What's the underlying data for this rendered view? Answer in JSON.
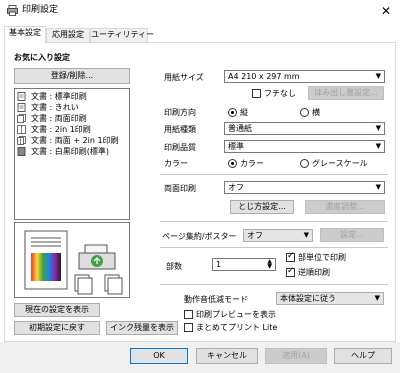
{
  "window": {
    "title": "印刷設定",
    "close_glyph": "✕"
  },
  "tabs": [
    {
      "label": "基本設定",
      "active": true
    },
    {
      "label": "応用設定",
      "active": false
    },
    {
      "label": "ユーティリティー",
      "active": false
    }
  ],
  "favorites": {
    "heading": "お気に入り設定",
    "register_button": "登録/削除...",
    "items": [
      {
        "label": "文書 : 標準印刷",
        "icon": "document-icon"
      },
      {
        "label": "文書 : きれい",
        "icon": "document-icon"
      },
      {
        "label": "文書 : 両面印刷",
        "icon": "duplex-icon"
      },
      {
        "label": "文書 : 2in 1印刷",
        "icon": "two-up-icon"
      },
      {
        "label": "文書 : 両面 + 2in 1印刷",
        "icon": "duplex-two-up-icon"
      },
      {
        "label": "文書 : 白黒印刷(標準)",
        "icon": "monochrome-icon"
      }
    ]
  },
  "left_buttons": {
    "show_current": "現在の設定を表示",
    "reset": "初期設定に戻す",
    "ink_levels": "インク残量を表示"
  },
  "settings": {
    "paper_size": {
      "label": "用紙サイズ",
      "value": "A4 210 x 297 mm"
    },
    "borderless": {
      "label": "フチなし",
      "checked": false
    },
    "overflow_button": "はみ出し量設定...",
    "orientation": {
      "label": "印刷方向",
      "options": [
        "縦",
        "横"
      ],
      "selected": "縦"
    },
    "paper_type": {
      "label": "用紙種類",
      "value": "普通紙"
    },
    "quality": {
      "label": "印刷品質",
      "value": "標準"
    },
    "color": {
      "label": "カラー",
      "options": [
        "カラー",
        "グレースケール"
      ],
      "selected": "カラー"
    },
    "duplex": {
      "label": "両面印刷",
      "value": "オフ"
    },
    "binding_button": "とじ方設定...",
    "density_button": "濃度調整...",
    "page_layout": {
      "label": "ページ集約/ポスター",
      "value": "オフ"
    },
    "layout_settings_button": "設定...",
    "copies": {
      "label": "部数",
      "value": "1"
    },
    "collate": {
      "label": "部単位で印刷",
      "checked": true
    },
    "reverse": {
      "label": "逆順印刷",
      "checked": true
    },
    "quiet_mode": {
      "label": "動作音低減モード",
      "value": "本体設定に従う"
    },
    "print_preview": {
      "label": "印刷プレビューを表示",
      "checked": false
    },
    "job_arranger": {
      "label": "まとめてプリント Lite",
      "checked": false
    }
  },
  "dialog_buttons": {
    "ok": "OK",
    "cancel": "キャンセル",
    "apply": "適用(A)",
    "help": "ヘルプ"
  },
  "colors": {
    "accent": "#0078d7",
    "disabled_text": "#a0a0a0"
  }
}
